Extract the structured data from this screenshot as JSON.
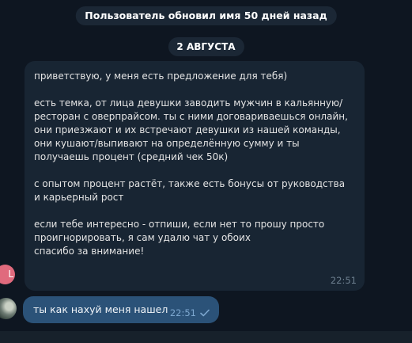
{
  "service": {
    "name_change": "Пользователь обновил имя 50 дней назад",
    "date": "2 АВГУСТА"
  },
  "incoming": {
    "text": "приветствую, у меня есть предложение для тебя)\n\nесть темка, от лица девушки заводить мужчин в кальянную/ресторан с овер­прайсом. ты с ними договариваешься онлайн, они приезжают и их встречают девушки из нашей команды, они кушают/выпивают на определённую сумму и ты получаешь процент (средний чек 50к)\n\nс опытом процент растёт, также есть бонусы от руководства и карьерный рост\n\nесли тебе интересно - отпиши, если нет то прошу просто проигнорировать, я сам удалю чат у обоих\nспасибо за внимание!",
    "time": "22:51",
    "avatar_letter": "L"
  },
  "outgoing": {
    "text": "ты как нахуй меня нашел",
    "time": "22:51",
    "status_icon": "check-icon"
  },
  "colors": {
    "background": "#0e1621",
    "incoming_bubble": "#182533",
    "outgoing_bubble": "#2b5278",
    "service_pill": "#1b2735"
  }
}
